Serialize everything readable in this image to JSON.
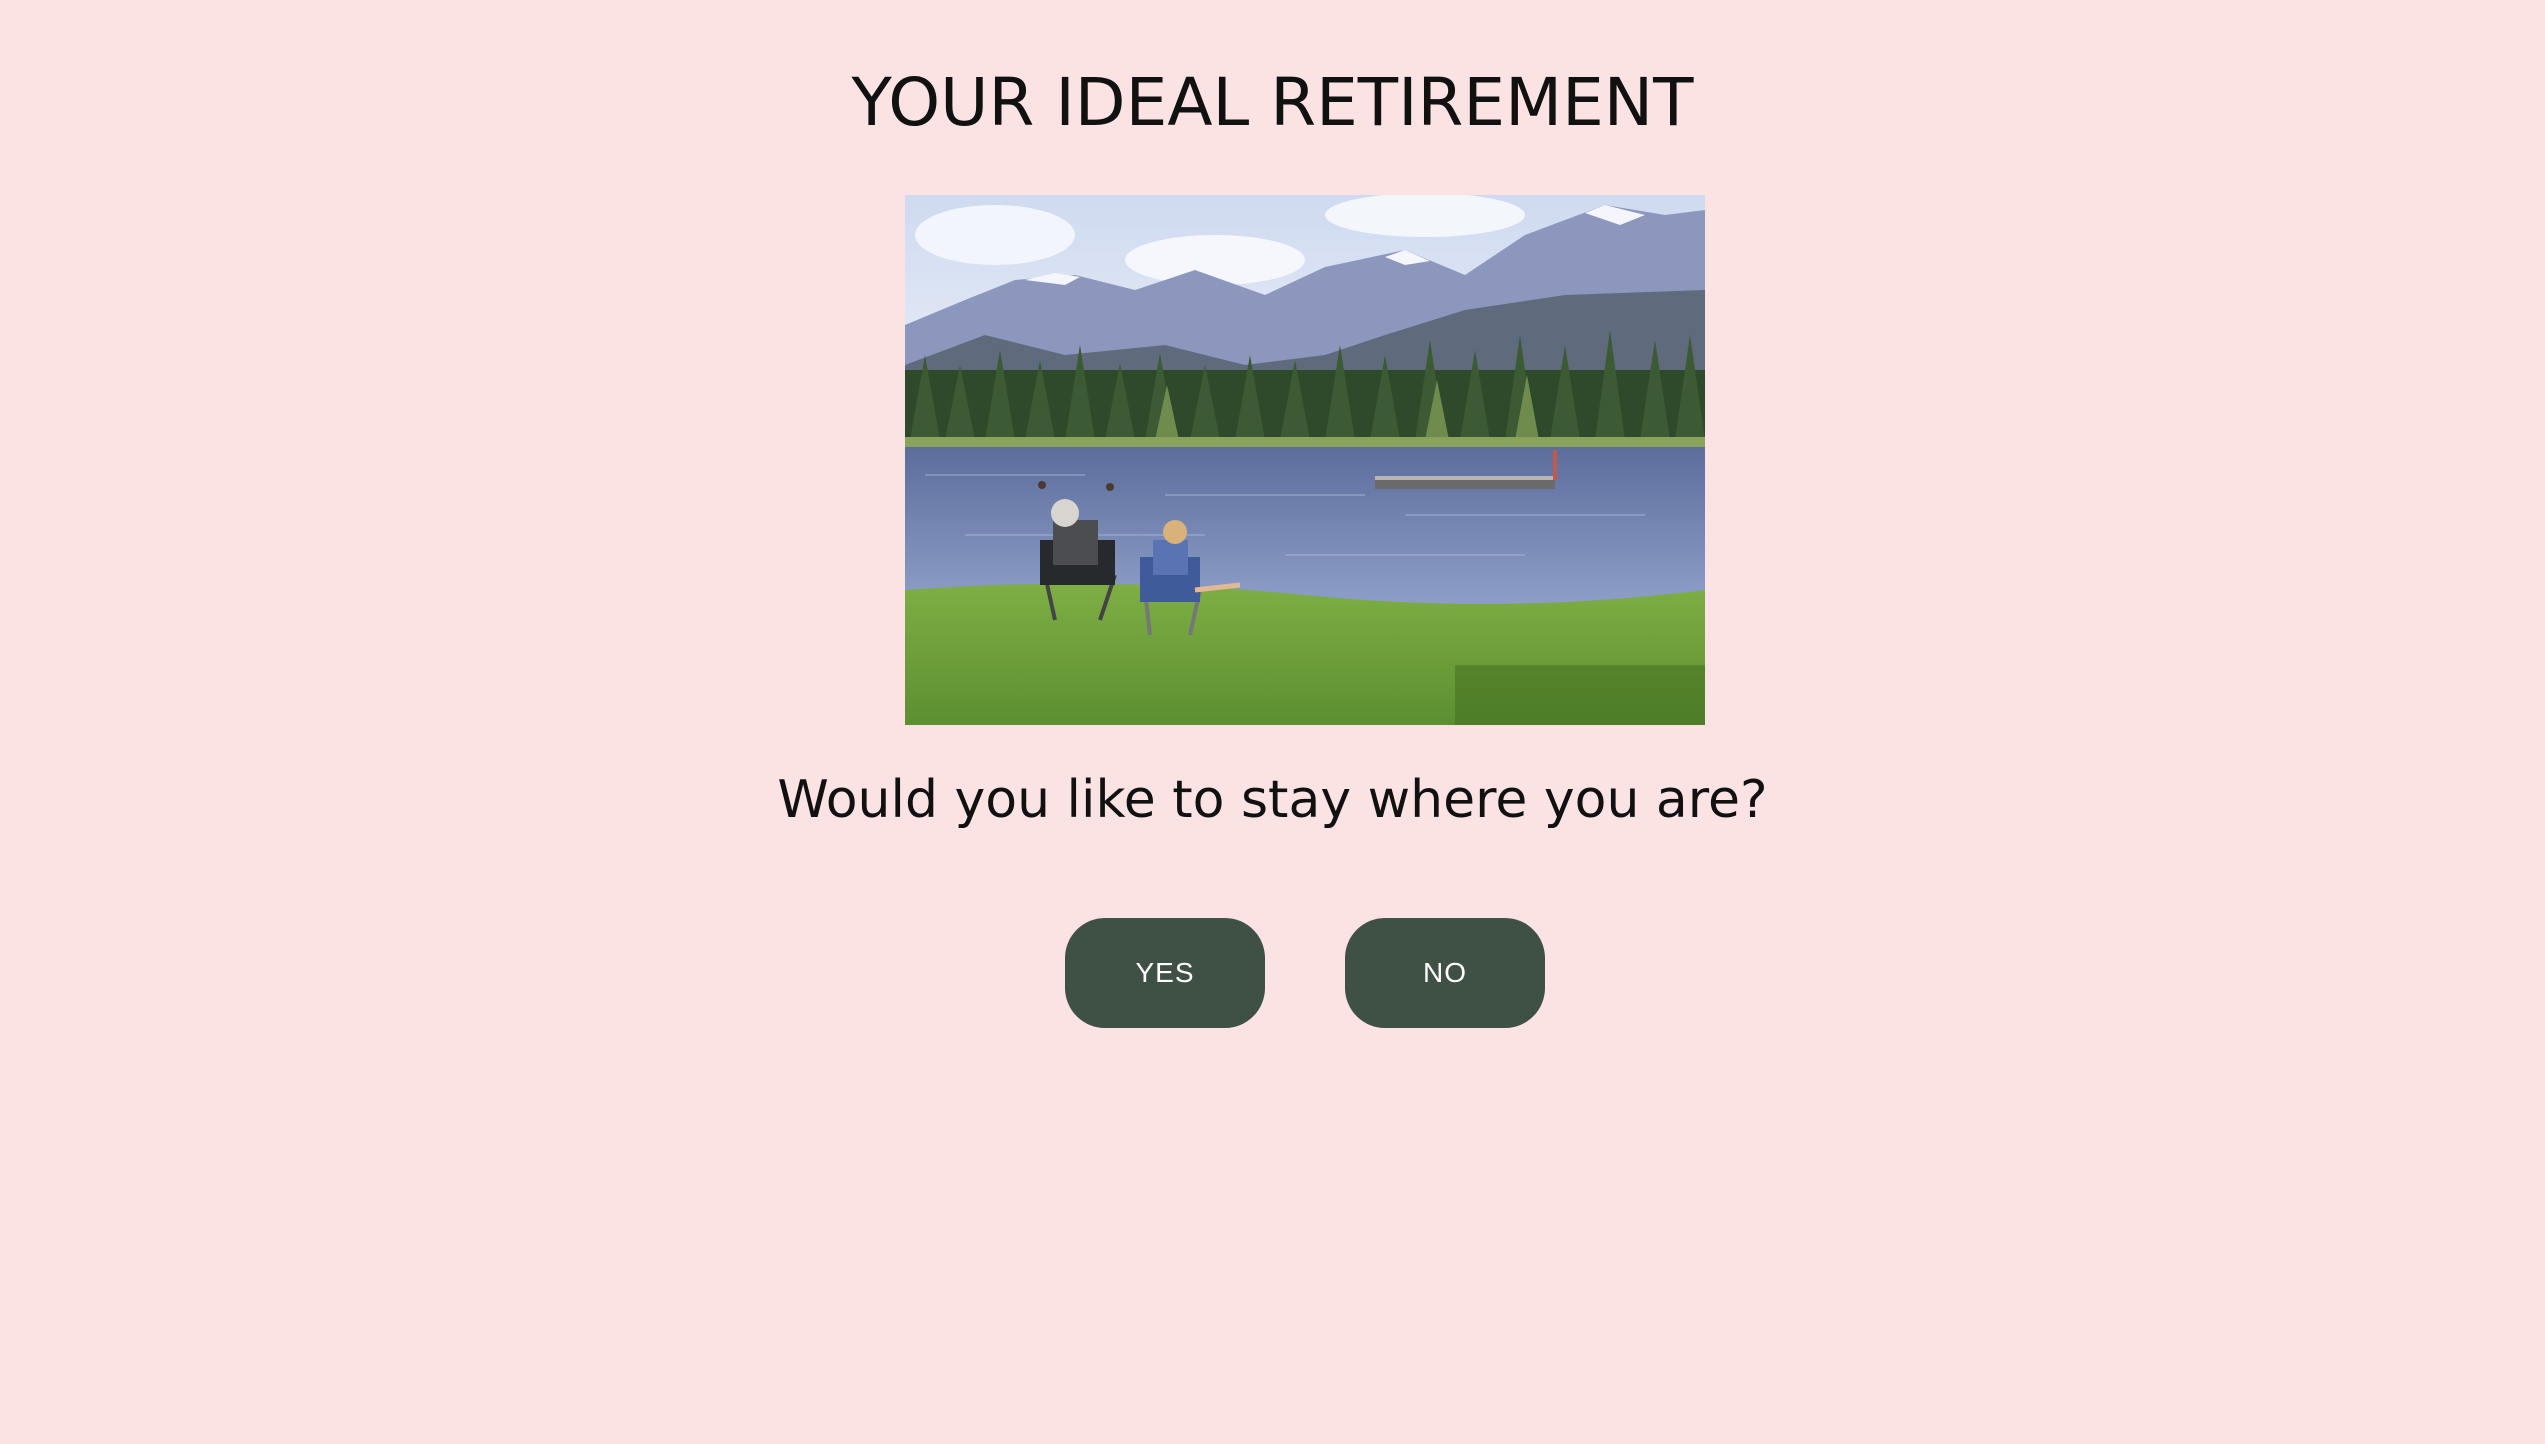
{
  "page": {
    "title": "YOUR IDEAL RETIREMENT",
    "question": "Would you like to stay where you are?"
  },
  "photo": {
    "subject": "lake-scene-with-seated-couple-and-mountains"
  },
  "answers": {
    "yes_label": "YES",
    "no_label": "NO"
  },
  "colors": {
    "background": "#fbe3e4",
    "button": "#3f5045",
    "button_text": "#ffffff",
    "text": "#111111"
  }
}
